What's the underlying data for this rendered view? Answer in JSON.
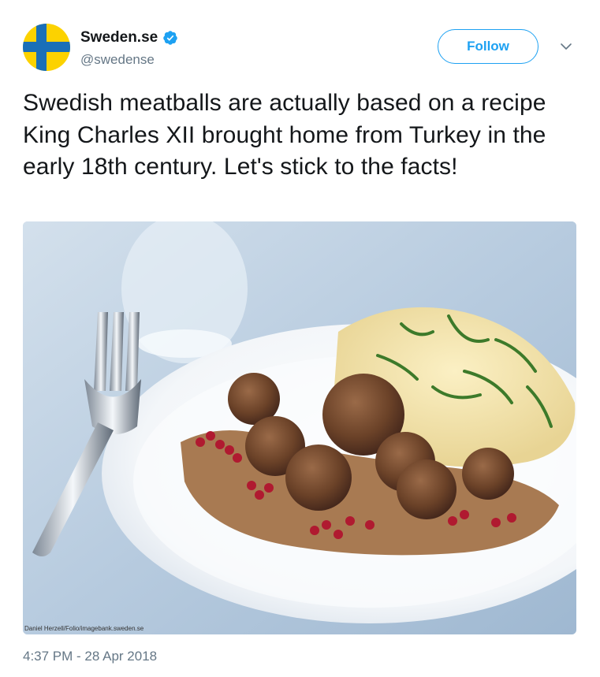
{
  "tweet": {
    "display_name": "Sweden.se",
    "handle": "@swedense",
    "follow_label": "Follow",
    "text": "Swedish meatballs are actually based on a recipe King Charles XII brought home from Turkey in the early 18th century. Let's stick to the facts!",
    "timestamp": "4:37 PM - 28 Apr 2018",
    "media": {
      "photo_credit": "Daniel Herzell/Folio/imagebank.sweden.se",
      "subject": "meatballs-with-mashed-potatoes-and-lingonberries"
    }
  },
  "icons": {
    "verified": "verified-badge-icon",
    "chevron": "chevron-down-icon",
    "avatar": "swedish-flag-avatar"
  },
  "colors": {
    "accent": "#1da1f2",
    "text": "#14171a",
    "secondary_text": "#657786",
    "flag_blue": "#1a6fb8",
    "flag_yellow": "#fcd200"
  }
}
